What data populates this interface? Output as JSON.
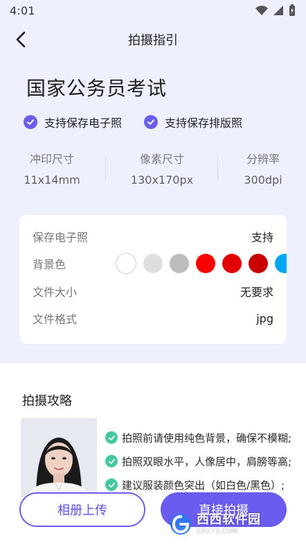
{
  "status_bar": {
    "time": "4:01",
    "icons": [
      "wifi-icon",
      "signal-icon",
      "battery-icon"
    ]
  },
  "header": {
    "title": "拍摄指引"
  },
  "exam": {
    "title": "国家公务员考试",
    "features": [
      "支持保存电子照",
      "支持保存排版照"
    ]
  },
  "specs": [
    {
      "label": "冲印尺寸",
      "value": "11x14mm"
    },
    {
      "label": "像素尺寸",
      "value": "130x170px"
    },
    {
      "label": "分辨率",
      "value": "300dpi"
    }
  ],
  "info": {
    "save_label": "保存电子照",
    "save_value": "支持",
    "bg_label": "背景色",
    "bg_colors": [
      "#ffffff",
      "#dedede",
      "#bdbbbb",
      "#ff0000",
      "#e20000",
      "#c80000",
      "#00a7f2"
    ],
    "size_label": "文件大小",
    "size_value": "无要求",
    "format_label": "文件格式",
    "format_value": "jpg"
  },
  "guide": {
    "title": "拍摄攻略",
    "tips": [
      "拍照前请使用纯色背景，确保不模糊;",
      "拍照双眼水平，人像居中，肩膀等高;",
      "建议服装颜色突出（如白色/黑色）;"
    ]
  },
  "buttons": {
    "upload": "相册上传",
    "shoot": "直接拍摄"
  },
  "watermark": {
    "main": "西西软件园",
    "sub": "CR173.COM"
  },
  "colors": {
    "accent": "#6b5cf0",
    "tip_check": "#43c99d",
    "bg_top": "#eef0ff"
  }
}
